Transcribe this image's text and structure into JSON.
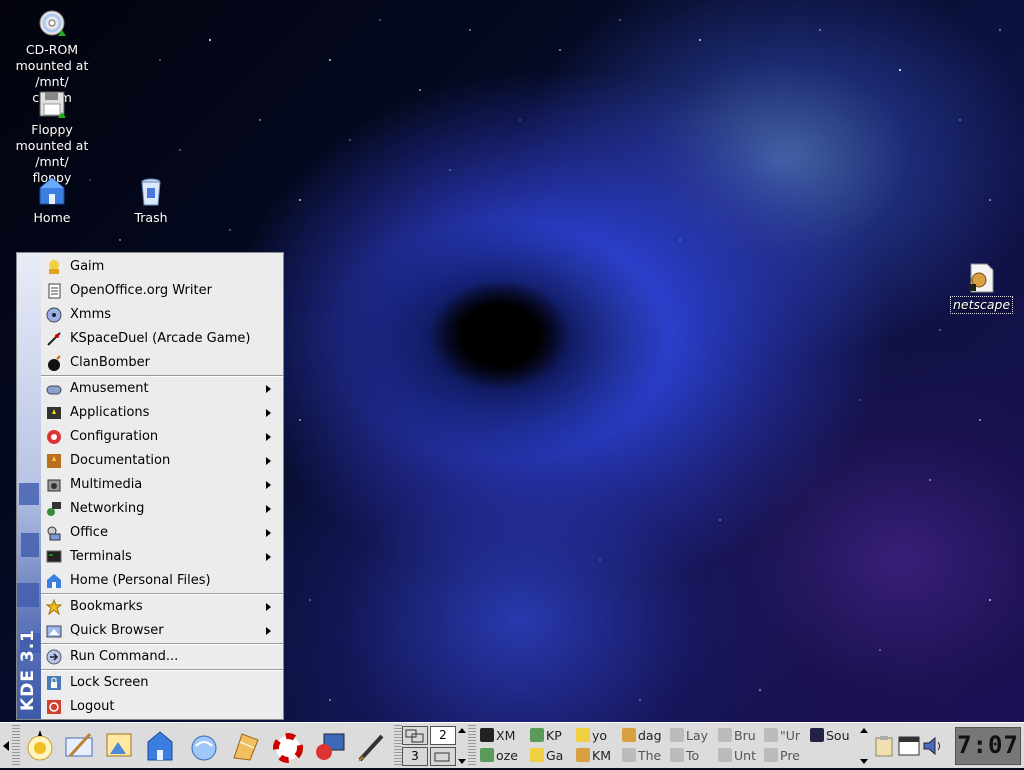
{
  "desktop": {
    "icons": {
      "cdrom": "CD-ROM mounted at /mnt/ cdrom",
      "cdrom_lines": [
        "CD-ROM",
        "mounted at /mnt/",
        "cdrom"
      ],
      "floppy_lines": [
        "Floppy",
        "mounted at /mnt/",
        "floppy"
      ],
      "home": "Home",
      "trash": "Trash",
      "netscape": "netscape"
    }
  },
  "kmenu": {
    "brand": "KDE 3.1",
    "recent": [
      "Gaim",
      "OpenOffice.org Writer",
      "Xmms",
      "KSpaceDuel (Arcade Game)",
      "ClanBomber"
    ],
    "categories": [
      "Amusement",
      "Applications",
      "Configuration",
      "Documentation",
      "Multimedia",
      "Networking",
      "Office",
      "Terminals"
    ],
    "home": "Home (Personal Files)",
    "bookmarks": "Bookmarks",
    "quick_browser": "Quick Browser",
    "run_command": "Run Command...",
    "lock_screen": "Lock Screen",
    "logout": "Logout"
  },
  "panel": {
    "pager": {
      "desk2": "2",
      "desk3": "3"
    },
    "tasks_row1": [
      "XM",
      "KP",
      "yo",
      "dag",
      "Lay",
      "Bru",
      "\"Ur",
      "Sou"
    ],
    "tasks_row2": [
      "oze",
      "Ga",
      "KM",
      "The",
      "To",
      "Unt",
      "Pre"
    ],
    "clock": "7:07"
  },
  "colors": {
    "menu_bg": "#ececec",
    "menu_strip": "#5c74b8",
    "panel_bg": "#dcdcdc"
  }
}
